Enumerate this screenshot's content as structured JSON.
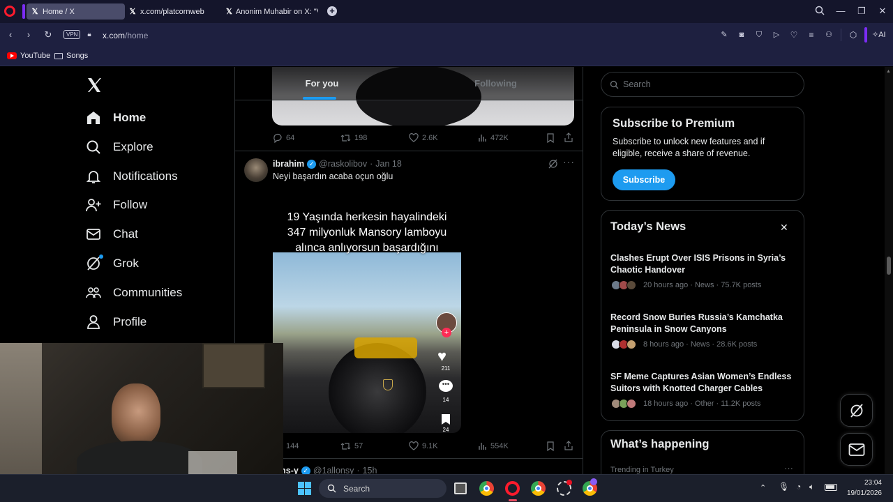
{
  "browser": {
    "tabs": [
      {
        "label": "Home / X",
        "active": true
      },
      {
        "label": "x.com/platcornweb",
        "active": false
      },
      {
        "label": "Anonim Muhabir on X: \"V",
        "active": false
      }
    ],
    "url_host": "x.com",
    "url_path": "/home",
    "vpn_label": "VPN",
    "ai_label": "AI",
    "bookmarks": [
      {
        "label": "YouTube",
        "icon": "youtube-icon"
      },
      {
        "label": "Songs",
        "icon": "folder-icon"
      }
    ]
  },
  "nav": {
    "items": [
      {
        "label": "Home",
        "icon": "home-icon"
      },
      {
        "label": "Explore",
        "icon": "search-icon"
      },
      {
        "label": "Notifications",
        "icon": "bell-icon"
      },
      {
        "label": "Follow",
        "icon": "add-person-icon"
      },
      {
        "label": "Chat",
        "icon": "mail-icon"
      },
      {
        "label": "Grok",
        "icon": "grok-icon"
      },
      {
        "label": "Communities",
        "icon": "communities-icon"
      },
      {
        "label": "Profile",
        "icon": "person-icon"
      }
    ]
  },
  "feed": {
    "tabs": {
      "for_you": "For you",
      "following": "Following"
    },
    "prev_post": {
      "replies": "64",
      "reposts": "198",
      "likes": "2.6K",
      "views": "472K"
    },
    "post": {
      "name": "ibrahim",
      "handle": "@raskolibov",
      "date": "Jan 18",
      "text": "Neyi başardın acaba oçun oğlu",
      "media_caption_line1": "19 Yaşında herkesin hayalindeki",
      "media_caption_line2": "347 milyonluk Mansory lamboyu",
      "media_caption_line3": "alınca anlıyorsun başardığını",
      "media_likes": "211",
      "media_comments": "14",
      "media_saves": "24",
      "replies": "144",
      "reposts": "57",
      "likes": "9.1K",
      "views": "554K"
    },
    "next_post": {
      "name": "lons-y",
      "handle": "@1allonsy",
      "date": "15h"
    }
  },
  "sidebar": {
    "search_placeholder": "Search",
    "premium": {
      "title": "Subscribe to Premium",
      "text": "Subscribe to unlock new features and if eligible, receive a share of revenue.",
      "button": "Subscribe"
    },
    "news": {
      "title": "Today’s News",
      "items": [
        {
          "title": "Clashes Erupt Over ISIS Prisons in Syria’s Chaotic Handover",
          "meta": "20 hours ago · News · 75.7K posts"
        },
        {
          "title": "Record Snow Buries Russia’s Kamchatka Peninsula in Snow Canyons",
          "meta": "8 hours ago · News · 28.6K posts"
        },
        {
          "title": "SF Meme Captures Asian Women’s Endless Suitors with Knotted Charger Cables",
          "meta": "18 hours ago · Other · 11.2K posts"
        }
      ]
    },
    "happening": {
      "title": "What’s happening",
      "trend_label": "Trending in Turkey"
    }
  },
  "taskbar": {
    "search_placeholder": "Search",
    "time": "23:04",
    "date": "19/01/2026"
  },
  "colors": {
    "accent": "#1d9bf0",
    "browser_bg": "#1e2040",
    "tabbar_bg": "#14152b",
    "opera_red": "#ff1b2d"
  }
}
